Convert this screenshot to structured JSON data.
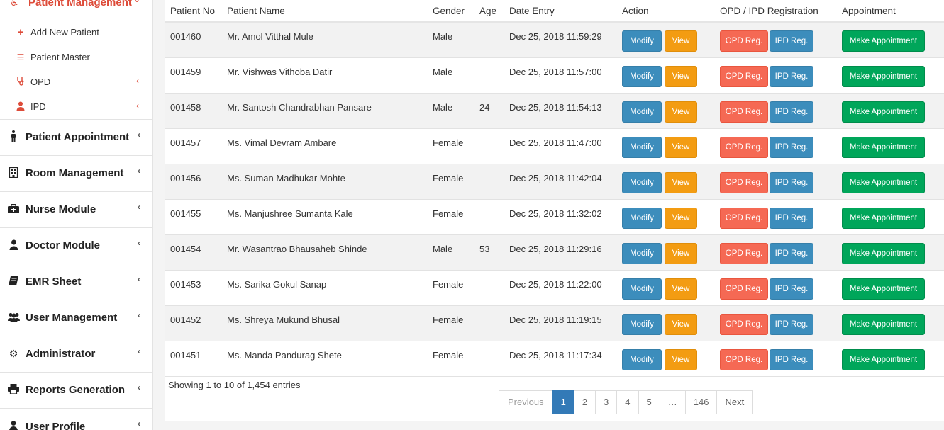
{
  "sidebar": {
    "header": {
      "label": "Patient Management"
    },
    "sub_items": [
      {
        "label": "Add New Patient",
        "icon": "plus-icon"
      },
      {
        "label": "Patient Master",
        "icon": "list-icon"
      },
      {
        "label": "OPD",
        "icon": "stethoscope-icon"
      },
      {
        "label": "IPD",
        "icon": "user-md-icon"
      }
    ],
    "items": [
      {
        "label": "Patient Appointment",
        "icon": "male-icon"
      },
      {
        "label": "Room Management",
        "icon": "building-icon"
      },
      {
        "label": "Nurse Module",
        "icon": "medkit-icon"
      },
      {
        "label": "Doctor Module",
        "icon": "user-md-icon"
      },
      {
        "label": "EMR Sheet",
        "icon": "book-icon"
      },
      {
        "label": "User Management",
        "icon": "users-icon"
      },
      {
        "label": "Administrator",
        "icon": "gear-icon"
      },
      {
        "label": "Reports Generation",
        "icon": "print-icon"
      },
      {
        "label": "User Profile",
        "icon": "user-icon"
      }
    ]
  },
  "table": {
    "headers": [
      "Patient No",
      "Patient Name",
      "Gender",
      "Age",
      "Date Entry",
      "Action",
      "OPD / IPD Registration",
      "Appointment"
    ],
    "buttons": {
      "modify": "Modify",
      "view": "View",
      "opd": "OPD Reg.",
      "ipd": "IPD Reg.",
      "appointment": "Make Appointment"
    },
    "rows": [
      {
        "no": "001460",
        "name": "Mr. Amol Vitthal Mule",
        "gender": "Male",
        "age": "",
        "date": "Dec 25, 2018 11:59:29"
      },
      {
        "no": "001459",
        "name": "Mr. Vishwas Vithoba Datir",
        "gender": "Male",
        "age": "",
        "date": "Dec 25, 2018 11:57:00"
      },
      {
        "no": "001458",
        "name": "Mr. Santosh Chandrabhan Pansare",
        "gender": "Male",
        "age": "24",
        "date": "Dec 25, 2018 11:54:13"
      },
      {
        "no": "001457",
        "name": "Ms. Vimal Devram Ambare",
        "gender": "Female",
        "age": "",
        "date": "Dec 25, 2018 11:47:00"
      },
      {
        "no": "001456",
        "name": "Ms. Suman Madhukar Mohte",
        "gender": "Female",
        "age": "",
        "date": "Dec 25, 2018 11:42:04"
      },
      {
        "no": "001455",
        "name": "Ms. Manjushree Sumanta Kale",
        "gender": "Female",
        "age": "",
        "date": "Dec 25, 2018 11:32:02"
      },
      {
        "no": "001454",
        "name": "Mr. Wasantrao Bhausaheb Shinde",
        "gender": "Male",
        "age": "53",
        "date": "Dec 25, 2018 11:29:16"
      },
      {
        "no": "001453",
        "name": "Ms. Sarika Gokul Sanap",
        "gender": "Female",
        "age": "",
        "date": "Dec 25, 2018 11:22:00"
      },
      {
        "no": "001452",
        "name": "Ms. Shreya Mukund Bhusal",
        "gender": "Female",
        "age": "",
        "date": "Dec 25, 2018 11:19:15"
      },
      {
        "no": "001451",
        "name": "Ms. Manda Pandurag Shete",
        "gender": "Female",
        "age": "",
        "date": "Dec 25, 2018 11:17:34"
      }
    ]
  },
  "footer": {
    "showing": "Showing 1 to 10 of 1,454 entries",
    "pagination": [
      "Previous",
      "1",
      "2",
      "3",
      "4",
      "5",
      "…",
      "146",
      "Next"
    ],
    "active_page": "1"
  },
  "colors": {
    "accent": "#dd4b39",
    "modify": "#3c8dbc",
    "view": "#f39c12",
    "opd": "#f56954",
    "ipd": "#3c8dbc",
    "appointment": "#00a65a",
    "active_page": "#337ab7"
  }
}
